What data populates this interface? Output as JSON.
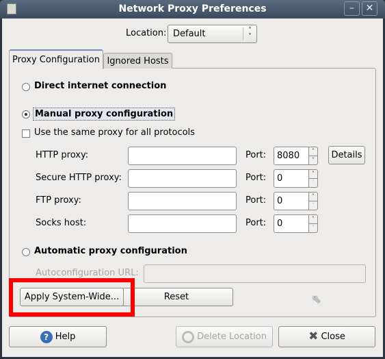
{
  "window": {
    "title": "Network Proxy Preferences"
  },
  "location": {
    "label": "Location:",
    "value": "Default"
  },
  "tabs": [
    {
      "label": "Proxy Configuration",
      "active": true
    },
    {
      "label": "Ignored Hosts",
      "active": false
    }
  ],
  "proxy": {
    "direct": {
      "label": "Direct internet connection",
      "selected": false
    },
    "manual": {
      "label": "Manual proxy configuration",
      "selected": true
    },
    "same_proxy": {
      "label": "Use the same proxy for all protocols",
      "checked": false
    },
    "rows": [
      {
        "label": "HTTP proxy:",
        "host": "",
        "port_label": "Port:",
        "port": "8080"
      },
      {
        "label": "Secure HTTP proxy:",
        "host": "",
        "port_label": "Port:",
        "port": "0"
      },
      {
        "label": "FTP proxy:",
        "host": "",
        "port_label": "Port:",
        "port": "0"
      },
      {
        "label": "Socks host:",
        "host": "",
        "port_label": "Port:",
        "port": "0"
      }
    ],
    "details_label": "Details",
    "automatic": {
      "label": "Automatic proxy configuration",
      "selected": false
    },
    "autoconfig_label": "Autoconfiguration URL:",
    "autoconfig_value": "",
    "apply_label": "Apply System-Wide...",
    "reset_label": "Reset"
  },
  "footer": {
    "help_label": "Help",
    "delete_label": "Delete Location",
    "close_label": "Close"
  },
  "colors": {
    "highlight": "#ff0000",
    "help_icon": "#3a6fb5"
  }
}
